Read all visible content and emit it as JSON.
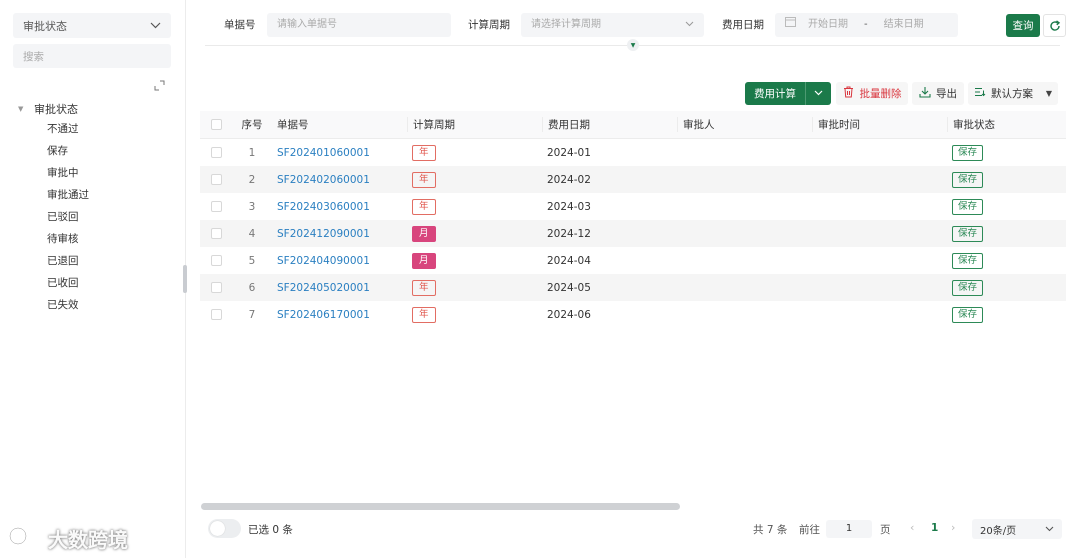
{
  "sidebar": {
    "select_value": "审批状态",
    "search_placeholder": "搜索",
    "tree_root": "审批状态",
    "items": [
      {
        "label": "不通过"
      },
      {
        "label": "保存"
      },
      {
        "label": "审批中"
      },
      {
        "label": "审批通过"
      },
      {
        "label": "已驳回"
      },
      {
        "label": "待审核"
      },
      {
        "label": "已退回"
      },
      {
        "label": "已收回"
      },
      {
        "label": "已失效"
      }
    ]
  },
  "filter": {
    "doc_no_label": "单据号",
    "doc_no_placeholder": "请输入单据号",
    "cycle_label": "计算周期",
    "cycle_placeholder": "请选择计算周期",
    "date_label": "费用日期",
    "date_start_placeholder": "开始日期",
    "date_sep": "-",
    "date_end_placeholder": "结束日期",
    "query_label": "查询"
  },
  "toolbar": {
    "calc_label": "费用计算",
    "batch_delete_label": "批量删除",
    "export_label": "导出",
    "scheme_label": "默认方案"
  },
  "table": {
    "headers": {
      "index": "序号",
      "doc_no": "单据号",
      "cycle": "计算周期",
      "date": "费用日期",
      "approver": "审批人",
      "approve_time": "审批时间",
      "status": "审批状态"
    },
    "rows": [
      {
        "index": "1",
        "doc_no": "SF202401060001",
        "cycle": "年",
        "cycle_type": "year",
        "date": "2024-01",
        "approver": "",
        "approve_time": "",
        "status": "保存"
      },
      {
        "index": "2",
        "doc_no": "SF202402060001",
        "cycle": "年",
        "cycle_type": "year",
        "date": "2024-02",
        "approver": "",
        "approve_time": "",
        "status": "保存"
      },
      {
        "index": "3",
        "doc_no": "SF202403060001",
        "cycle": "年",
        "cycle_type": "year",
        "date": "2024-03",
        "approver": "",
        "approve_time": "",
        "status": "保存"
      },
      {
        "index": "4",
        "doc_no": "SF202412090001",
        "cycle": "月",
        "cycle_type": "month",
        "date": "2024-12",
        "approver": "",
        "approve_time": "",
        "status": "保存"
      },
      {
        "index": "5",
        "doc_no": "SF202404090001",
        "cycle": "月",
        "cycle_type": "month",
        "date": "2024-04",
        "approver": "",
        "approve_time": "",
        "status": "保存"
      },
      {
        "index": "6",
        "doc_no": "SF202405020001",
        "cycle": "年",
        "cycle_type": "year",
        "date": "2024-05",
        "approver": "",
        "approve_time": "",
        "status": "保存"
      },
      {
        "index": "7",
        "doc_no": "SF202406170001",
        "cycle": "年",
        "cycle_type": "year",
        "date": "2024-06",
        "approver": "",
        "approve_time": "",
        "status": "保存"
      }
    ]
  },
  "footer": {
    "selected_text": "已选 0 条",
    "total_text": "共 7 条",
    "goto_text": "前往",
    "goto_value": "1",
    "page_text": "页",
    "current_page": "1",
    "page_size": "20条/页"
  },
  "watermark": {
    "text": "大数跨境"
  },
  "colors": {
    "primary": "#1b7a4a",
    "link": "#2a7fc1",
    "danger": "#d9363e",
    "tag_month": "#d8457d",
    "tag_year": "#e0534a"
  }
}
